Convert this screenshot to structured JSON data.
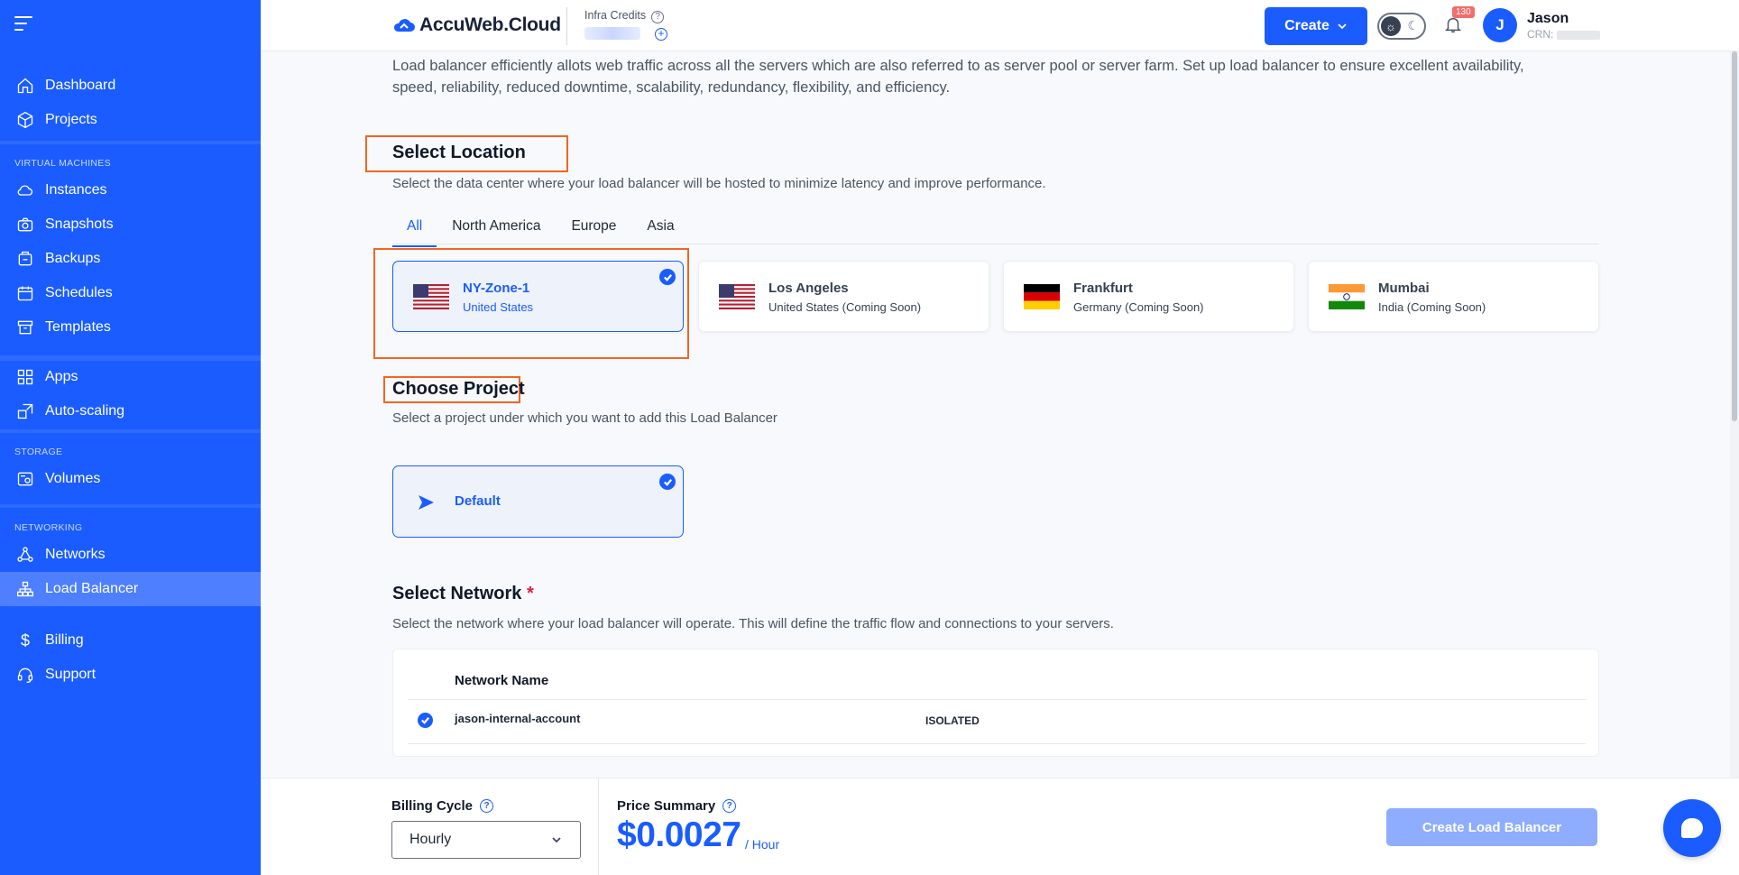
{
  "sidebar": {
    "group1": [
      {
        "label": "Dashboard",
        "icon": "home-icon"
      },
      {
        "label": "Projects",
        "icon": "cube-icon"
      }
    ],
    "vm_label": "VIRTUAL MACHINES",
    "vm_items": [
      {
        "label": "Instances",
        "icon": "cloud-icon"
      },
      {
        "label": "Snapshots",
        "icon": "camera-icon"
      },
      {
        "label": "Backups",
        "icon": "backup-icon"
      },
      {
        "label": "Schedules",
        "icon": "calendar-icon"
      },
      {
        "label": "Templates",
        "icon": "archive-icon"
      }
    ],
    "apps_items": [
      {
        "label": "Apps",
        "icon": "grid-icon"
      },
      {
        "label": "Auto-scaling",
        "icon": "scale-icon"
      }
    ],
    "storage_label": "STORAGE",
    "storage_items": [
      {
        "label": "Volumes",
        "icon": "database-icon"
      }
    ],
    "networking_label": "NETWORKING",
    "networking_items": [
      {
        "label": "Networks",
        "icon": "network-icon"
      },
      {
        "label": "Load Balancer",
        "icon": "hierarchy-icon",
        "active": true
      }
    ],
    "bottom_items": [
      {
        "label": "Billing",
        "icon": "dollar-icon"
      },
      {
        "label": "Support",
        "icon": "headset-icon"
      }
    ]
  },
  "header": {
    "logo_text": "AccuWeb.Cloud",
    "credits_label": "Infra Credits",
    "create_label": "Create",
    "notification_count": "130",
    "avatar_initial": "J",
    "user_name": "Jason",
    "user_crn_prefix": "CRN: "
  },
  "main": {
    "intro": "Load balancer efficiently allots web traffic across all the servers which are also referred to as server pool or server farm. Set up load balancer to ensure excellent availability, speed, reliability, reduced downtime, scalability, redundancy, flexibility, and efficiency.",
    "location": {
      "title": "Select Location",
      "subtitle": "Select the data center where your load balancer will be hosted to minimize latency and improve performance.",
      "tabs": [
        "All",
        "North America",
        "Europe",
        "Asia"
      ],
      "active_tab": "All",
      "cards": [
        {
          "name": "NY-Zone-1",
          "country": "United States",
          "flag": "us-flag-icon",
          "selected": true
        },
        {
          "name": "Los Angeles",
          "country": "United States (Coming Soon)",
          "flag": "us-flag-icon",
          "selected": false
        },
        {
          "name": "Frankfurt",
          "country": "Germany (Coming Soon)",
          "flag": "germany-flag-icon",
          "selected": false
        },
        {
          "name": "Mumbai",
          "country": "India (Coming Soon)",
          "flag": "india-flag-icon",
          "selected": false
        }
      ]
    },
    "project": {
      "title": "Choose Project",
      "subtitle": "Select a project under which you want to add this Load Balancer",
      "card_name": "Default"
    },
    "network": {
      "title": "Select Network",
      "required_mark": "*",
      "subtitle": "Select the network where your load balancer will operate. This will define the traffic flow and connections to your servers.",
      "column_header": "Network Name",
      "rows": [
        {
          "name": "jason-internal-account",
          "type": "ISOLATED",
          "selected": true
        }
      ]
    }
  },
  "footer": {
    "billing_cycle_label": "Billing Cycle",
    "billing_cycle_value": "Hourly",
    "price_summary_label": "Price Summary",
    "price": "$0.0027",
    "price_unit": "/ Hour",
    "create_button": "Create Load Balancer"
  },
  "colors": {
    "brand": "#1a5cff",
    "highlight": "#f26522",
    "sidebar_active": "#4d7fff"
  }
}
